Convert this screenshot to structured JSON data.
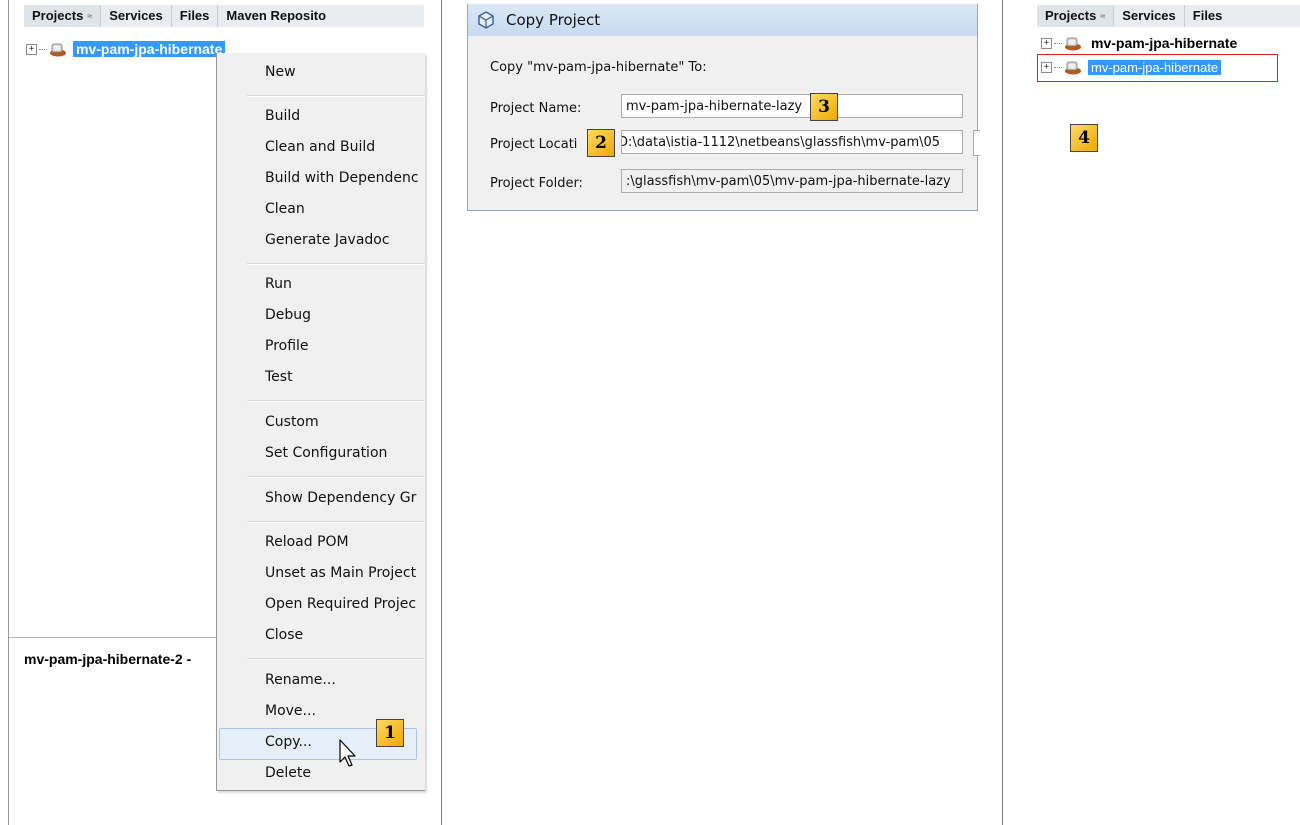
{
  "left_panel": {
    "tabs": [
      {
        "label": "Projects",
        "close": "≈"
      },
      {
        "label": "Services"
      },
      {
        "label": "Files"
      },
      {
        "label": "Maven Reposito"
      }
    ],
    "project_node": "mv-pam-jpa-hibernate",
    "bottom_panel_label": "mv-pam-jpa-hibernate-2 -",
    "context_menu": {
      "items": [
        "New",
        "Build",
        "Clean and Build",
        "Build with Dependenc",
        "Clean",
        "Generate Javadoc",
        "Run",
        "Debug",
        "Profile",
        "Test",
        "Custom",
        "Set Configuration",
        "Show Dependency Gr",
        "Reload POM",
        "Unset as Main Project",
        "Open Required Projec",
        "Close",
        "Rename...",
        "Move...",
        "Copy...",
        "Delete"
      ],
      "hovered_item": "Copy..."
    }
  },
  "dialog": {
    "title": "Copy Project",
    "intro": "Copy \"mv-pam-jpa-hibernate\" To:",
    "project_name_label": "Project Name:",
    "project_name_value": "mv-pam-jpa-hibernate-lazy",
    "project_location_label": "Project Locati",
    "project_location_value": "D:\\data\\istia-1112\\netbeans\\glassfish\\mv-pam\\05",
    "project_folder_label": "Project Folder:",
    "project_folder_value": ":\\glassfish\\mv-pam\\05\\mv-pam-jpa-hibernate-lazy"
  },
  "right_panel": {
    "tabs": [
      {
        "label": "Projects",
        "close": "≈"
      },
      {
        "label": "Services"
      },
      {
        "label": "Files"
      }
    ],
    "nodes": [
      {
        "label": "mv-pam-jpa-hibernate",
        "selected": false
      },
      {
        "label": "mv-pam-jpa-hibernate",
        "selected": true
      }
    ]
  },
  "badges": {
    "b1": "1",
    "b2": "2",
    "b3": "3",
    "b4": "4"
  },
  "colors": {
    "selection": "#3399ff",
    "badge": "#f5b400",
    "highlight_box": "#e02020"
  }
}
